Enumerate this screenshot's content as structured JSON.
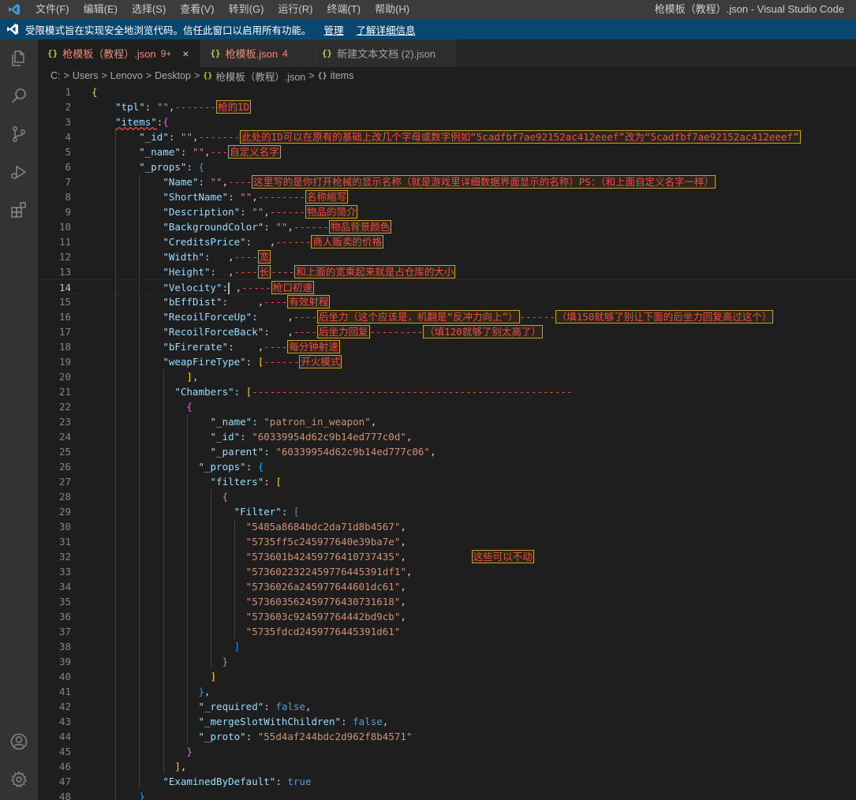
{
  "titlebar": {
    "menu": [
      "文件(F)",
      "编辑(E)",
      "选择(S)",
      "查看(V)",
      "转到(G)",
      "运行(R)",
      "终端(T)",
      "帮助(H)"
    ],
    "window_title": "枪模板（教程）.json - Visual Studio Code"
  },
  "banner": {
    "text": "受限模式旨在实现安全地浏览代码。信任此窗口以启用所有功能。",
    "manage": "管理",
    "learn_more": "了解详细信息"
  },
  "tabs": [
    {
      "label": "枪模板（教程）.json",
      "count": "9+",
      "close": "×"
    },
    {
      "label": "枪模板.json",
      "count": "4"
    },
    {
      "label": "新建文本文档 (2).json"
    }
  ],
  "tab_icon": "{}",
  "breadcrumb": {
    "parts": [
      "C:",
      "Users",
      "Lenovo",
      "Desktop",
      "枪模板（教程）.json",
      "items"
    ],
    "sep": ">",
    "json_icon": "{}",
    "symbol_icon": "{}"
  },
  "editor": {
    "current_line": 14,
    "lines": [
      {
        "n": "1",
        "tokens": [
          [
            "b1",
            "{"
          ]
        ]
      },
      {
        "n": "2",
        "tokens": [
          [
            "p",
            "    "
          ],
          [
            "k",
            "\"tpl\""
          ],
          [
            "p",
            ": "
          ],
          [
            "s",
            "\"\""
          ],
          [
            "p",
            ","
          ],
          [
            "dash",
            "-------"
          ],
          [
            "note",
            "枪的ID"
          ]
        ]
      },
      {
        "n": "3",
        "tokens": [
          [
            "p",
            "    "
          ],
          [
            "k err",
            "\"items\""
          ],
          [
            "p",
            ":"
          ],
          [
            "b2",
            "{"
          ]
        ]
      },
      {
        "n": "4",
        "tokens": [
          [
            "p",
            "        "
          ],
          [
            "k",
            "\"_id\""
          ],
          [
            "p",
            ": "
          ],
          [
            "s",
            "\"\""
          ],
          [
            "p",
            ","
          ],
          [
            "dash",
            "-------"
          ],
          [
            "note",
            "此处的ID可以在原有的基础上改几个字母或数字例如“5cadfbf7ae92152ac412eeef”改为“5cadfbf7ae92152ac412eeef”"
          ]
        ]
      },
      {
        "n": "5",
        "tokens": [
          [
            "p",
            "        "
          ],
          [
            "k",
            "\"_name\""
          ],
          [
            "p",
            ": "
          ],
          [
            "s",
            "\"\""
          ],
          [
            "p",
            ","
          ],
          [
            "dash",
            "---"
          ],
          [
            "note",
            "自定义名字"
          ]
        ]
      },
      {
        "n": "6",
        "tokens": [
          [
            "p",
            "        "
          ],
          [
            "k",
            "\"_props\""
          ],
          [
            "p",
            ": "
          ],
          [
            "b3",
            "{"
          ]
        ]
      },
      {
        "n": "7",
        "tokens": [
          [
            "p",
            "            "
          ],
          [
            "k",
            "\"Name\""
          ],
          [
            "p",
            ": "
          ],
          [
            "s",
            "\"\""
          ],
          [
            "p",
            ","
          ],
          [
            "dash",
            "----"
          ],
          [
            "note",
            "这里写的是你打开枪械的显示名称（就是游戏里详细数据界面显示的名称）PS：（和上面自定义名字一样）"
          ]
        ]
      },
      {
        "n": "8",
        "tokens": [
          [
            "p",
            "            "
          ],
          [
            "k",
            "\"ShortName\""
          ],
          [
            "p",
            ": "
          ],
          [
            "s",
            "\"\""
          ],
          [
            "p",
            ","
          ],
          [
            "dash",
            "--------"
          ],
          [
            "note",
            "名称缩写"
          ]
        ]
      },
      {
        "n": "9",
        "tokens": [
          [
            "p",
            "            "
          ],
          [
            "k",
            "\"Description\""
          ],
          [
            "p",
            ": "
          ],
          [
            "s",
            "\"\""
          ],
          [
            "p",
            ","
          ],
          [
            "dash",
            "------"
          ],
          [
            "note",
            "物品的简介"
          ]
        ]
      },
      {
        "n": "10",
        "tokens": [
          [
            "p",
            "            "
          ],
          [
            "k",
            "\"BackgroundColor\""
          ],
          [
            "p",
            ": "
          ],
          [
            "s",
            "\"\""
          ],
          [
            "p",
            ","
          ],
          [
            "dash",
            "------"
          ],
          [
            "note",
            "物品背景颜色"
          ]
        ]
      },
      {
        "n": "11",
        "tokens": [
          [
            "p",
            "            "
          ],
          [
            "k",
            "\"CreditsPrice\""
          ],
          [
            "p",
            ":   ,"
          ],
          [
            "dash",
            "------"
          ],
          [
            "note",
            "商人贩卖的价格"
          ]
        ]
      },
      {
        "n": "12",
        "tokens": [
          [
            "p",
            "            "
          ],
          [
            "k",
            "\"Width\""
          ],
          [
            "p",
            ":   ,"
          ],
          [
            "dash",
            "----"
          ],
          [
            "note",
            "宽"
          ]
        ]
      },
      {
        "n": "13",
        "tokens": [
          [
            "p",
            "            "
          ],
          [
            "k",
            "\"Height\""
          ],
          [
            "p",
            ":  ,"
          ],
          [
            "dash",
            "----"
          ],
          [
            "note",
            "长"
          ],
          [
            "dash",
            "----"
          ],
          [
            "note",
            "和上面的宽乘起来就是占仓库的大小"
          ]
        ]
      },
      {
        "n": "14",
        "tokens": [
          [
            "p",
            "            "
          ],
          [
            "k",
            "\"Velocity\""
          ],
          [
            "p",
            ":"
          ],
          [
            "cursor",
            ""
          ],
          [
            "p",
            " ,"
          ],
          [
            "dash",
            "-----"
          ],
          [
            "note",
            "枪口初速"
          ]
        ]
      },
      {
        "n": "15",
        "tokens": [
          [
            "p",
            "            "
          ],
          [
            "k",
            "\"bEffDist\""
          ],
          [
            "p",
            ":     ,"
          ],
          [
            "dash",
            "----"
          ],
          [
            "note",
            "有效射程"
          ]
        ]
      },
      {
        "n": "16",
        "tokens": [
          [
            "p",
            "            "
          ],
          [
            "k",
            "\"RecoilForceUp\""
          ],
          [
            "p",
            ":     ,"
          ],
          [
            "dash",
            "----"
          ],
          [
            "note",
            "后坐力（这个应该是，机翻是“反冲力向上”）"
          ],
          [
            "dash",
            "------"
          ],
          [
            "note",
            "（填150就够了别让下面的后坐力回复高过这个）"
          ]
        ]
      },
      {
        "n": "17",
        "tokens": [
          [
            "p",
            "            "
          ],
          [
            "k",
            "\"RecoilForceBack\""
          ],
          [
            "p",
            ":   ,"
          ],
          [
            "dash",
            "----"
          ],
          [
            "note",
            "后坐力回复"
          ],
          [
            "dash",
            "---------"
          ],
          [
            "note",
            "（填120就够了别太高了）"
          ]
        ]
      },
      {
        "n": "18",
        "tokens": [
          [
            "p",
            "            "
          ],
          [
            "k",
            "\"bFirerate\""
          ],
          [
            "p",
            ":    ,"
          ],
          [
            "dash",
            "----"
          ],
          [
            "note",
            "每分钟射速"
          ]
        ]
      },
      {
        "n": "19",
        "tokens": [
          [
            "p",
            "            "
          ],
          [
            "k",
            "\"weapFireType\""
          ],
          [
            "p",
            ": "
          ],
          [
            "b1",
            "["
          ],
          [
            "dash",
            "------"
          ],
          [
            "note",
            "开火模式"
          ]
        ]
      },
      {
        "n": "20",
        "tokens": [
          [
            "p",
            "                "
          ],
          [
            "b1",
            "]"
          ],
          [
            "p",
            ","
          ]
        ]
      },
      {
        "n": "21",
        "tokens": [
          [
            "p",
            "              "
          ],
          [
            "k",
            "\"Chambers\""
          ],
          [
            "p",
            ": "
          ],
          [
            "b1",
            "["
          ],
          [
            "dash",
            "------------------------------------------------------"
          ]
        ]
      },
      {
        "n": "22",
        "tokens": [
          [
            "p",
            "                "
          ],
          [
            "b2",
            "{"
          ]
        ]
      },
      {
        "n": "23",
        "tokens": [
          [
            "p",
            "                    "
          ],
          [
            "k",
            "\"_name\""
          ],
          [
            "p",
            ": "
          ],
          [
            "s",
            "\"patron_in_weapon\""
          ],
          [
            "p",
            ","
          ]
        ]
      },
      {
        "n": "24",
        "tokens": [
          [
            "p",
            "                    "
          ],
          [
            "k",
            "\"_id\""
          ],
          [
            "p",
            ": "
          ],
          [
            "s",
            "\"60339954d62c9b14ed777c0d\""
          ],
          [
            "p",
            ","
          ]
        ]
      },
      {
        "n": "25",
        "tokens": [
          [
            "p",
            "                    "
          ],
          [
            "k",
            "\"_parent\""
          ],
          [
            "p",
            ": "
          ],
          [
            "s",
            "\"60339954d62c9b14ed777c06\""
          ],
          [
            "p",
            ","
          ]
        ]
      },
      {
        "n": "26",
        "tokens": [
          [
            "p",
            "                  "
          ],
          [
            "k",
            "\"_props\""
          ],
          [
            "p",
            ": "
          ],
          [
            "b3",
            "{"
          ]
        ]
      },
      {
        "n": "27",
        "tokens": [
          [
            "p",
            "                    "
          ],
          [
            "k",
            "\"filters\""
          ],
          [
            "p",
            ": "
          ],
          [
            "b1",
            "["
          ]
        ]
      },
      {
        "n": "28",
        "tokens": [
          [
            "p",
            "                      "
          ],
          [
            "b2",
            "{"
          ]
        ]
      },
      {
        "n": "29",
        "tokens": [
          [
            "p",
            "                        "
          ],
          [
            "k",
            "\"Filter\""
          ],
          [
            "p",
            ": "
          ],
          [
            "b3",
            "["
          ]
        ]
      },
      {
        "n": "30",
        "tokens": [
          [
            "p",
            "                          "
          ],
          [
            "s",
            "\"5485a8684bdc2da71d8b4567\""
          ],
          [
            "p",
            ","
          ]
        ]
      },
      {
        "n": "31",
        "tokens": [
          [
            "p",
            "                          "
          ],
          [
            "s",
            "\"5735ff5c245977640e39ba7e\""
          ],
          [
            "p",
            ","
          ]
        ]
      },
      {
        "n": "32",
        "tokens": [
          [
            "p",
            "                          "
          ],
          [
            "s",
            "\"573601b42459776410737435\""
          ],
          [
            "p",
            ",           "
          ],
          [
            "note",
            "这些可以不动"
          ]
        ]
      },
      {
        "n": "33",
        "tokens": [
          [
            "p",
            "                          "
          ],
          [
            "s",
            "\"5736022322459776445391df1\""
          ],
          [
            "p",
            ","
          ]
        ]
      },
      {
        "n": "34",
        "tokens": [
          [
            "p",
            "                          "
          ],
          [
            "s",
            "\"5736026a245977644601dc61\""
          ],
          [
            "p",
            ","
          ]
        ]
      },
      {
        "n": "35",
        "tokens": [
          [
            "p",
            "                          "
          ],
          [
            "s",
            "\"57360356245977643073161​8\""
          ],
          [
            "p",
            ","
          ]
        ]
      },
      {
        "n": "36",
        "tokens": [
          [
            "p",
            "                          "
          ],
          [
            "s",
            "\"573603c924597764442bd9cb\""
          ],
          [
            "p",
            ","
          ]
        ]
      },
      {
        "n": "37",
        "tokens": [
          [
            "p",
            "                          "
          ],
          [
            "s",
            "\"5735fdcd2459776445391d61\""
          ]
        ]
      },
      {
        "n": "38",
        "tokens": [
          [
            "p",
            "                        "
          ],
          [
            "b3",
            "]"
          ]
        ]
      },
      {
        "n": "39",
        "tokens": [
          [
            "p",
            "                      "
          ],
          [
            "b2",
            "}"
          ]
        ]
      },
      {
        "n": "40",
        "tokens": [
          [
            "p",
            "                    "
          ],
          [
            "b1",
            "]"
          ]
        ]
      },
      {
        "n": "41",
        "tokens": [
          [
            "p",
            "                  "
          ],
          [
            "b3",
            "}"
          ],
          [
            "p",
            ","
          ]
        ]
      },
      {
        "n": "42",
        "tokens": [
          [
            "p",
            "                  "
          ],
          [
            "k",
            "\"_required\""
          ],
          [
            "p",
            ": "
          ],
          [
            "kw",
            "false"
          ],
          [
            "p",
            ","
          ]
        ]
      },
      {
        "n": "43",
        "tokens": [
          [
            "p",
            "                  "
          ],
          [
            "k",
            "\"_mergeSlotWithChildren\""
          ],
          [
            "p",
            ": "
          ],
          [
            "kw",
            "false"
          ],
          [
            "p",
            ","
          ]
        ]
      },
      {
        "n": "44",
        "tokens": [
          [
            "p",
            "                  "
          ],
          [
            "k",
            "\"_proto\""
          ],
          [
            "p",
            ": "
          ],
          [
            "s",
            "\"55d4af244bdc2d962f8b4571\""
          ]
        ]
      },
      {
        "n": "45",
        "tokens": [
          [
            "p",
            "                "
          ],
          [
            "b2",
            "}"
          ]
        ]
      },
      {
        "n": "46",
        "tokens": [
          [
            "p",
            "              "
          ],
          [
            "b1",
            "]"
          ],
          [
            "p",
            ","
          ]
        ]
      },
      {
        "n": "47",
        "tokens": [
          [
            "p",
            "            "
          ],
          [
            "k",
            "\"ExaminedByDefault\""
          ],
          [
            "p",
            ": "
          ],
          [
            "kw",
            "true"
          ]
        ]
      },
      {
        "n": "48",
        "tokens": [
          [
            "p",
            "        "
          ],
          [
            "b3",
            "}"
          ]
        ]
      }
    ]
  }
}
